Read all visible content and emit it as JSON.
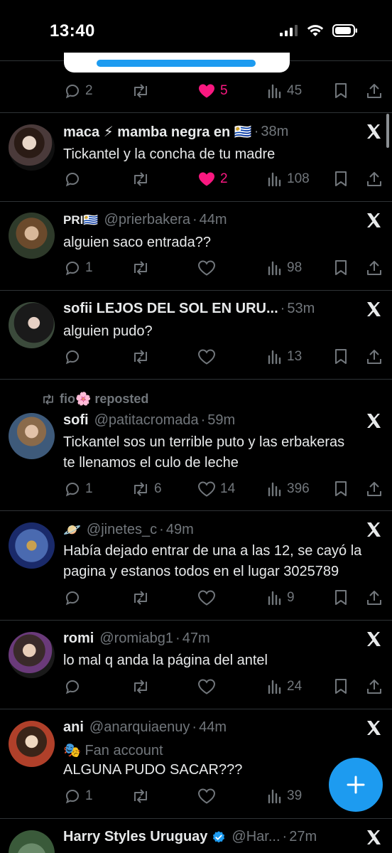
{
  "status_bar": {
    "time": "13:40"
  },
  "tweets": [
    {
      "id": "prev",
      "actions": {
        "replies": "2",
        "reposts": "",
        "likes": "5",
        "views": "45",
        "liked": true
      }
    },
    {
      "id": "maca",
      "name": "maca ⚡ mamba negra en 🇺🇾",
      "handle": "",
      "time": "38m",
      "text": "Tickantel y la concha de tu madre",
      "actions": {
        "replies": "",
        "reposts": "",
        "likes": "2",
        "views": "108",
        "liked": true
      }
    },
    {
      "id": "pri",
      "name": "PRI🇺🇾",
      "handle": "@prierbakera",
      "time": "44m",
      "text": "alguien saco entrada??",
      "actions": {
        "replies": "1",
        "reposts": "",
        "likes": "",
        "views": "98",
        "liked": false
      }
    },
    {
      "id": "sofii",
      "name": "sofii LEJOS DEL SOL EN URU...",
      "handle": "",
      "time": "53m",
      "text": "alguien pudo?",
      "actions": {
        "replies": "",
        "reposts": "",
        "likes": "",
        "views": "13",
        "liked": false
      }
    },
    {
      "id": "sofi",
      "repost_by": "fio🌸 reposted",
      "name": "sofi",
      "handle": "@patitacromada",
      "time": "59m",
      "text_line1": "Tickantel sos un terrible puto y las erbakeras",
      "text_line2": "te llenamos el culo de leche",
      "actions": {
        "replies": "1",
        "reposts": "6",
        "likes": "14",
        "views": "396",
        "liked": false
      }
    },
    {
      "id": "jinetes",
      "name": "🪐",
      "handle": "@jinetes_c",
      "time": "49m",
      "text_line1": "Había dejado entrar de una a las 12, se cayó la",
      "text_line2": "pagina y estanos todos en el lugar 3025789",
      "actions": {
        "replies": "",
        "reposts": "",
        "likes": "",
        "views": "9",
        "liked": false
      }
    },
    {
      "id": "romi",
      "name": "romi",
      "handle": "@romiabg1",
      "time": "47m",
      "text": "lo mal q anda la página del antel",
      "actions": {
        "replies": "",
        "reposts": "",
        "likes": "",
        "views": "24",
        "liked": false
      }
    },
    {
      "id": "ani",
      "name": "ani",
      "handle": "@anarquiaenuy",
      "time": "44m",
      "subline": "🎭 Fan account",
      "text": "ALGUNA PUDO SACAR???",
      "actions": {
        "replies": "1",
        "reposts": "",
        "likes": "",
        "views": "39",
        "liked": false
      }
    },
    {
      "id": "harry",
      "name": "Harry Styles Uruguay",
      "handle": "@Har...",
      "time": "27m"
    }
  ],
  "colors": {
    "accent": "#1d9bf0",
    "like": "#f91880",
    "muted": "#71767b",
    "text": "#e7e9ea"
  },
  "icons": [
    "reply-icon",
    "repost-icon",
    "like-icon",
    "views-icon",
    "bookmark-icon",
    "share-icon",
    "x-logo-icon",
    "compose-plus-icon"
  ]
}
